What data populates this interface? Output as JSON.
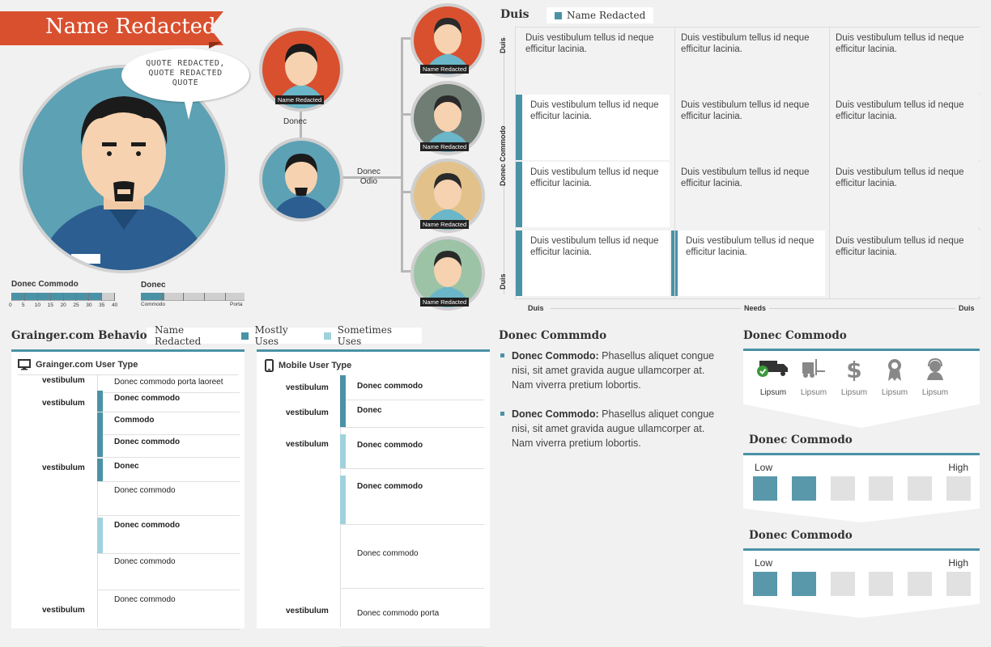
{
  "persona": {
    "name": "Name Redacted",
    "quote": "QUOTE REDACTED,\nQUOTE REDACTED\nQUOTE",
    "scale1": {
      "label": "Donec Commodo",
      "ticks": [
        "0",
        "5",
        "10",
        "15",
        "20",
        "25",
        "30",
        "35",
        "40"
      ],
      "value": 35
    },
    "scale2": {
      "label": "Donec",
      "left": "Commodo",
      "right": "Porta",
      "value": 0.23
    }
  },
  "tree": {
    "top": {
      "tag": "Name Redacted"
    },
    "mid_label": "Donec",
    "branch_label": [
      "Donec",
      "Odio"
    ],
    "children": [
      {
        "tag": "Name Redacted",
        "bg": "#d9502f"
      },
      {
        "tag": "Name Redacted",
        "bg": "#6f7d74"
      },
      {
        "tag": "Name Redacted",
        "bg": "#e2c28a"
      },
      {
        "tag": "Name Redacted",
        "bg": "#9cc3a6"
      }
    ]
  },
  "matrix": {
    "title": "Duis",
    "legend": "Name Redacted",
    "y_labels": [
      "Duis",
      "Donec Commodo",
      "Duis"
    ],
    "x_labels": [
      "Duis",
      "Needs",
      "Duis"
    ],
    "cell_text": "Duis vestibulum tellus id neque efficitur lacinia."
  },
  "behavior": {
    "title": "Grainger.com Behavior",
    "legend": {
      "name": "Name Redacted",
      "mostly": "Mostly Uses",
      "sometimes": "Sometimes Uses"
    },
    "colors": {
      "mostly": "#4a92a6",
      "sometimes": "#9fd2dd",
      "accent": "#4a92a6"
    },
    "web": {
      "title": "Grainger.com User Type",
      "row_labels": [
        "vestibulum",
        "vestibulum",
        "vestibulum",
        "vestibulum"
      ],
      "items": [
        "Donec commodo porta laoreet",
        "Donec commodo",
        "Commodo",
        "Donec commodo",
        "Donec",
        "Donec commodo",
        "Donec commodo",
        "Donec commodo",
        "Donec commodo"
      ]
    },
    "mobile": {
      "title": "Mobile User Type",
      "row_labels": [
        "vestibulum",
        "vestibulum",
        "vestibulum",
        "vestibulum"
      ],
      "items": [
        "Donec commodo",
        "Donec",
        "Donec commodo",
        "Donec commodo",
        "Donec commodo",
        "Donec commodo porta"
      ]
    }
  },
  "commodo": {
    "title": "Donec Commmdo",
    "bullets": [
      {
        "bold": "Donec Commodo:",
        "text": " Phasellus aliquet congue nisi, sit amet gravida augue ullamcorper at. Nam viverra pretium lobortis."
      },
      {
        "bold": "Donec Commodo:",
        "text": " Phasellus aliquet congue nisi, sit amet gravida augue ullamcorper at. Nam viverra pretium lobortis."
      }
    ]
  },
  "right": {
    "icons_title": "Donec Commodo",
    "icons": [
      {
        "label": "Lipsum",
        "icon": "delivery-truck-icon"
      },
      {
        "label": "Lipsum",
        "icon": "forklift-icon"
      },
      {
        "label": "Lipsum",
        "icon": "dollar-icon"
      },
      {
        "label": "Lipsum",
        "icon": "award-ribbon-icon"
      },
      {
        "label": "Lipsum",
        "icon": "support-person-icon"
      }
    ],
    "scales": [
      {
        "title": "Donec Commodo",
        "low": "Low",
        "high": "High",
        "filled": 2,
        "total": 6
      },
      {
        "title": "Donec Commodo",
        "low": "Low",
        "high": "High",
        "filled": 2,
        "total": 6
      }
    ]
  }
}
